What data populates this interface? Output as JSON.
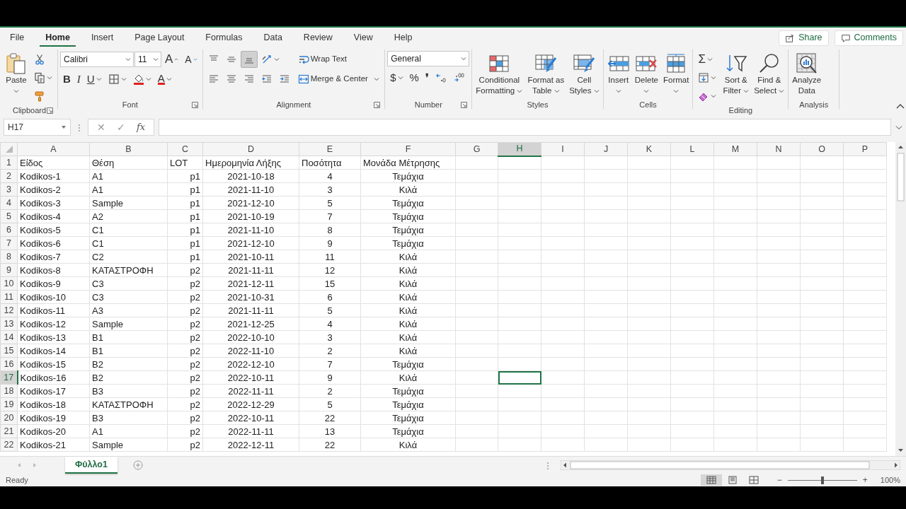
{
  "ribbon_tabs": [
    {
      "label": "File",
      "selected": false
    },
    {
      "label": "Home",
      "selected": true
    },
    {
      "label": "Insert",
      "selected": false
    },
    {
      "label": "Page Layout",
      "selected": false
    },
    {
      "label": "Formulas",
      "selected": false
    },
    {
      "label": "Data",
      "selected": false
    },
    {
      "label": "Review",
      "selected": false
    },
    {
      "label": "View",
      "selected": false
    },
    {
      "label": "Help",
      "selected": false
    }
  ],
  "header_buttons": [
    {
      "kind": "share",
      "label": "Share"
    },
    {
      "kind": "comment",
      "label": "Comments"
    }
  ],
  "ribbon_groups": [
    {
      "label": "Clipboard",
      "launcher": true,
      "items": [
        {
          "kind": "paste",
          "label": "Paste",
          "dropdown": true
        },
        {
          "kind": "stack",
          "lines": [
            {
              "controls": [
                {
                  "kind": "cut"
                }
              ]
            },
            {
              "controls": [
                {
                  "kind": "copy",
                  "dropdown": true
                }
              ]
            },
            {
              "controls": [
                {
                  "kind": "format-painter"
                }
              ]
            }
          ]
        }
      ]
    },
    {
      "label": "Font",
      "launcher": true,
      "items": [
        {
          "kind": "stack",
          "lines": [
            {
              "controls": [
                {
                  "kind": "font-name",
                  "value": "Calibri"
                },
                {
                  "kind": "font-size",
                  "value": "11"
                },
                {
                  "kind": "grow-font",
                  "text": "A"
                },
                {
                  "kind": "shrink-font",
                  "text": "A"
                }
              ]
            },
            {
              "controls": [
                {
                  "kind": "bold",
                  "text": "B"
                },
                {
                  "kind": "italic",
                  "text": "I"
                },
                {
                  "kind": "underline",
                  "text": "U",
                  "dropdown": true
                },
                {
                  "kind": "borders",
                  "dropdown": true
                },
                {
                  "kind": "fill-color",
                  "dropdown": true
                },
                {
                  "kind": "font-color",
                  "text": "A",
                  "dropdown": true
                }
              ]
            }
          ]
        }
      ]
    },
    {
      "label": "Alignment",
      "launcher": true,
      "items": [
        {
          "kind": "stack",
          "lines": [
            {
              "controls": [
                {
                  "kind": "align-top",
                  "pressed": false
                },
                {
                  "kind": "align-middle",
                  "pressed": false
                },
                {
                  "kind": "align-bottom",
                  "pressed": true
                },
                {
                  "kind": "orientation",
                  "dropdown": true
                }
              ]
            },
            {
              "controls": [
                {
                  "kind": "align-left"
                },
                {
                  "kind": "align-center"
                },
                {
                  "kind": "align-right"
                },
                {
                  "kind": "outdent"
                },
                {
                  "kind": "indent"
                }
              ]
            }
          ]
        },
        {
          "kind": "stack",
          "lines": [
            {
              "controls": [
                {
                  "kind": "wrap-text",
                  "label": "Wrap Text"
                }
              ]
            },
            {
              "controls": [
                {
                  "kind": "merge",
                  "label": "Merge & Center",
                  "dropdown": true
                }
              ]
            }
          ]
        }
      ]
    },
    {
      "label": "Number",
      "launcher": true,
      "items": [
        {
          "kind": "stack",
          "lines": [
            {
              "controls": [
                {
                  "kind": "number-format",
                  "value": "General"
                }
              ]
            },
            {
              "controls": [
                {
                  "kind": "currency",
                  "text": "$",
                  "dropdown": true
                },
                {
                  "kind": "percent",
                  "text": "%"
                },
                {
                  "kind": "comma",
                  "text": "❜"
                },
                {
                  "kind": "increase-decimal"
                },
                {
                  "kind": "decrease-decimal"
                }
              ]
            }
          ]
        }
      ]
    },
    {
      "label": "Styles",
      "items": [
        {
          "kind": "conditional-formatting",
          "label": "Conditional Formatting",
          "dropdown": true
        },
        {
          "kind": "format-as-table",
          "label": "Format as Table",
          "dropdown": true
        },
        {
          "kind": "cell-styles",
          "label": "Cell Styles",
          "dropdown": true
        }
      ]
    },
    {
      "label": "Cells",
      "items": [
        {
          "kind": "insert",
          "label": "Insert",
          "dropdown": true
        },
        {
          "kind": "delete",
          "label": "Delete",
          "dropdown": true
        },
        {
          "kind": "format",
          "label": "Format",
          "dropdown": true
        }
      ]
    },
    {
      "label": "Editing",
      "items": [
        {
          "kind": "stack",
          "lines": [
            {
              "controls": [
                {
                  "kind": "autosum",
                  "text": "Σ",
                  "dropdown": true
                }
              ]
            },
            {
              "controls": [
                {
                  "kind": "fill-down",
                  "dropdown": true
                }
              ]
            },
            {
              "controls": [
                {
                  "kind": "clear",
                  "dropdown": true
                }
              ]
            }
          ]
        },
        {
          "kind": "sort-filter",
          "label": "Sort & Filter",
          "dropdown": true
        },
        {
          "kind": "find-select",
          "label": "Find & Select",
          "dropdown": true
        }
      ]
    },
    {
      "label": "Analysis",
      "items": [
        {
          "kind": "analyze-data",
          "label": "Analyze Data"
        }
      ]
    }
  ],
  "formula_bar": {
    "name_box": "H17",
    "cancel": "✕",
    "enter": "✓",
    "function": "fx"
  },
  "columns": [
    {
      "letter": "A",
      "selected": false
    },
    {
      "letter": "B",
      "selected": false
    },
    {
      "letter": "C",
      "selected": false
    },
    {
      "letter": "D",
      "selected": false
    },
    {
      "letter": "E",
      "selected": false
    },
    {
      "letter": "F",
      "selected": false
    },
    {
      "letter": "G",
      "selected": false
    },
    {
      "letter": "H",
      "selected": true
    },
    {
      "letter": "I",
      "selected": false
    },
    {
      "letter": "J",
      "selected": false
    },
    {
      "letter": "K",
      "selected": false
    },
    {
      "letter": "L",
      "selected": false
    },
    {
      "letter": "M",
      "selected": false
    },
    {
      "letter": "N",
      "selected": false
    },
    {
      "letter": "O",
      "selected": false
    },
    {
      "letter": "P",
      "selected": false
    }
  ],
  "header_row": {
    "number": "1",
    "selected": false,
    "cells": [
      "Είδος",
      "Θέση",
      "LOT",
      "Ημερομηνία Λήξης",
      "Ποσότητα",
      "Μονάδα Μέτρησης"
    ]
  },
  "rows": [
    {
      "number": "2",
      "selected": false,
      "cells": [
        "Kodikos-1",
        "A1",
        "p1",
        "2021-10-18",
        "4",
        "Τεμάχια"
      ]
    },
    {
      "number": "3",
      "selected": false,
      "cells": [
        "Kodikos-2",
        "A1",
        "p1",
        "2021-11-10",
        "3",
        "Κιλά"
      ]
    },
    {
      "number": "4",
      "selected": false,
      "cells": [
        "Kodikos-3",
        "Sample",
        "p1",
        "2021-12-10",
        "5",
        "Τεμάχια"
      ]
    },
    {
      "number": "5",
      "selected": false,
      "cells": [
        "Kodikos-4",
        "A2",
        "p1",
        "2021-10-19",
        "7",
        "Τεμάχια"
      ]
    },
    {
      "number": "6",
      "selected": false,
      "cells": [
        "Kodikos-5",
        "C1",
        "p1",
        "2021-11-10",
        "8",
        "Τεμάχια"
      ]
    },
    {
      "number": "7",
      "selected": false,
      "cells": [
        "Kodikos-6",
        "C1",
        "p1",
        "2021-12-10",
        "9",
        "Τεμάχια"
      ]
    },
    {
      "number": "8",
      "selected": false,
      "cells": [
        "Kodikos-7",
        "C2",
        "p1",
        "2021-10-11",
        "11",
        "Κιλά"
      ]
    },
    {
      "number": "9",
      "selected": false,
      "cells": [
        "Kodikos-8",
        "ΚΑΤΑΣΤΡΟΦΗ",
        "p2",
        "2021-11-11",
        "12",
        "Κιλά"
      ]
    },
    {
      "number": "10",
      "selected": false,
      "cells": [
        "Kodikos-9",
        "C3",
        "p2",
        "2021-12-11",
        "15",
        "Κιλά"
      ]
    },
    {
      "number": "11",
      "selected": false,
      "cells": [
        "Kodikos-10",
        "C3",
        "p2",
        "2021-10-31",
        "6",
        "Κιλά"
      ]
    },
    {
      "number": "12",
      "selected": false,
      "cells": [
        "Kodikos-11",
        "A3",
        "p2",
        "2021-11-11",
        "5",
        "Κιλά"
      ]
    },
    {
      "number": "13",
      "selected": false,
      "cells": [
        "Kodikos-12",
        "Sample",
        "p2",
        "2021-12-25",
        "4",
        "Κιλά"
      ]
    },
    {
      "number": "14",
      "selected": false,
      "cells": [
        "Kodikos-13",
        "B1",
        "p2",
        "2022-10-10",
        "3",
        "Κιλά"
      ]
    },
    {
      "number": "15",
      "selected": false,
      "cells": [
        "Kodikos-14",
        "B1",
        "p2",
        "2022-11-10",
        "2",
        "Κιλά"
      ]
    },
    {
      "number": "16",
      "selected": false,
      "cells": [
        "Kodikos-15",
        "B2",
        "p2",
        "2022-12-10",
        "7",
        "Τεμάχια"
      ]
    },
    {
      "number": "17",
      "selected": true,
      "cells": [
        "Kodikos-16",
        "B2",
        "p2",
        "2022-10-11",
        "9",
        "Κιλά"
      ]
    },
    {
      "number": "18",
      "selected": false,
      "cells": [
        "Kodikos-17",
        "B3",
        "p2",
        "2022-11-11",
        "2",
        "Τεμάχια"
      ]
    },
    {
      "number": "19",
      "selected": false,
      "cells": [
        "Kodikos-18",
        "ΚΑΤΑΣΤΡΟΦΗ",
        "p2",
        "2022-12-29",
        "5",
        "Τεμάχια"
      ]
    },
    {
      "number": "20",
      "selected": false,
      "cells": [
        "Kodikos-19",
        "B3",
        "p2",
        "2022-10-11",
        "22",
        "Τεμάχια"
      ]
    },
    {
      "number": "21",
      "selected": false,
      "cells": [
        "Kodikos-20",
        "A1",
        "p2",
        "2022-11-11",
        "13",
        "Τεμάχια"
      ]
    },
    {
      "number": "22",
      "selected": false,
      "cells": [
        "Kodikos-21",
        "Sample",
        "p2",
        "2022-12-11",
        "22",
        "Κιλά"
      ]
    }
  ],
  "sheet_tabs": [
    {
      "label": "Φύλλο1",
      "selected": true
    }
  ],
  "status_bar": {
    "status": "Ready",
    "views": [
      {
        "kind": "normal",
        "selected": true
      },
      {
        "kind": "page_layout",
        "selected": false
      },
      {
        "kind": "page_break",
        "selected": false
      }
    ],
    "zoom_out": "−",
    "zoom": {
      "level": 0.5
    },
    "zoom_in": "+",
    "zoom_reading": "100%"
  }
}
